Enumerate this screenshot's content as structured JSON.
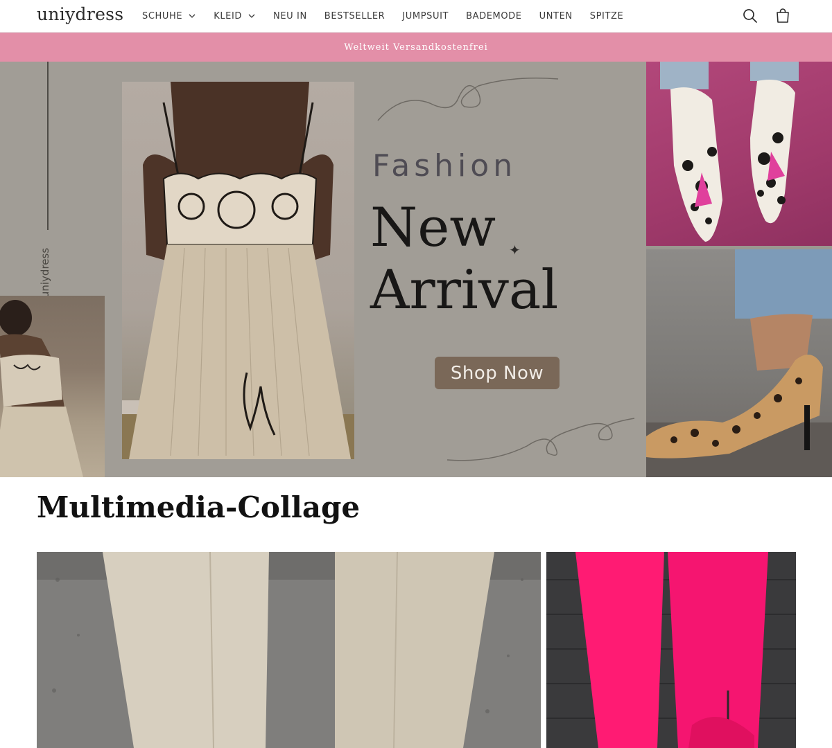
{
  "header": {
    "logo": "uniydress",
    "nav": [
      {
        "label": "SCHUHE",
        "dropdown": true
      },
      {
        "label": "KLEID",
        "dropdown": true
      },
      {
        "label": "NEU IN",
        "dropdown": false
      },
      {
        "label": "BESTSELLER",
        "dropdown": false
      },
      {
        "label": "JUMPSUIT",
        "dropdown": false
      },
      {
        "label": "BADEMODE",
        "dropdown": false
      },
      {
        "label": "UNTEN",
        "dropdown": false
      },
      {
        "label": "SPITZE",
        "dropdown": false
      }
    ],
    "icons": [
      "search-icon",
      "cart-icon"
    ]
  },
  "announcement": {
    "text": "Weltweit Versandkostenfrei",
    "background": "#e38fa8"
  },
  "hero": {
    "side_brand": "uniydress",
    "eyebrow": "Fashion",
    "headline_line1": "New",
    "headline_line2": "Arrival",
    "cta_label": "Shop Now",
    "cta_color": "#7a6858"
  },
  "collage": {
    "title": "Multimedia-Collage"
  },
  "colors": {
    "accent_pink": "#e38fa8",
    "hot_pink": "#ff1b73",
    "hero_overlay": "#a19d96"
  }
}
